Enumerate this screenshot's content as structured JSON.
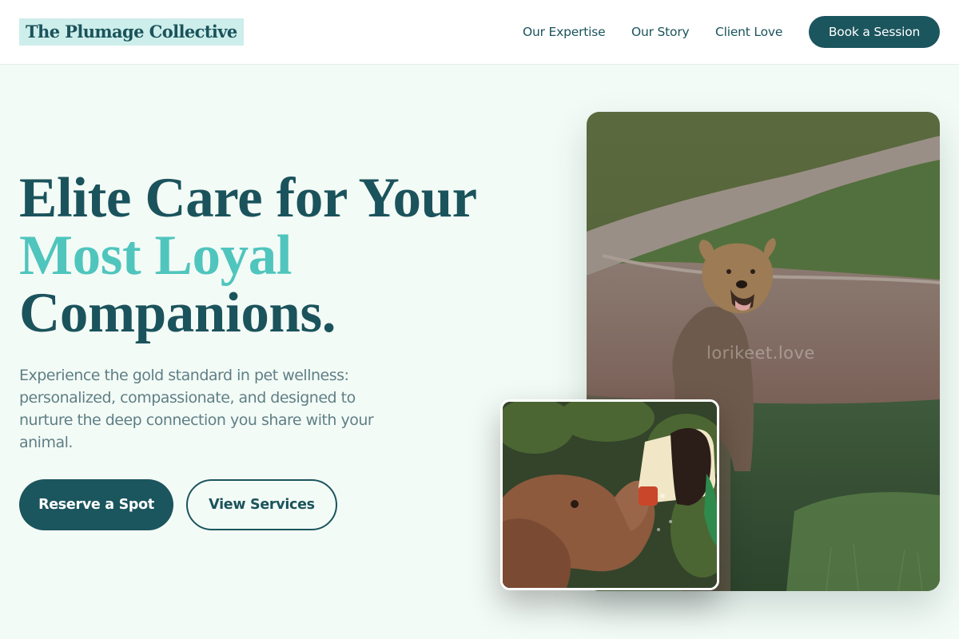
{
  "brand": {
    "name": "The Plumage Collective"
  },
  "nav": {
    "links": [
      "Our Expertise",
      "Our Story",
      "Client Love"
    ],
    "cta": "Book a Session"
  },
  "hero": {
    "headline": {
      "line1": "Elite Care for Your",
      "line2": "Most Loyal",
      "line3": "Companions."
    },
    "subtext": "Experience the gold standard in pet wellness: personalized, compassionate, and designed to nurture the deep connection you share with your animal.",
    "primary_cta": "Reserve a Spot",
    "secondary_cta": "View Services"
  },
  "images": {
    "main_photo": {
      "subject": "dog sitting on grass beside a brick path",
      "watermark": "lorikeet.love"
    },
    "inset_photo": {
      "subject": "baby elephant drinking from a milk bottle"
    }
  },
  "colors": {
    "primary": "#1b555d",
    "accent": "#4fc5bd",
    "background": "#f3fbf6",
    "brand_highlight": "#cdeeea",
    "body_text": "#5f7f86"
  }
}
